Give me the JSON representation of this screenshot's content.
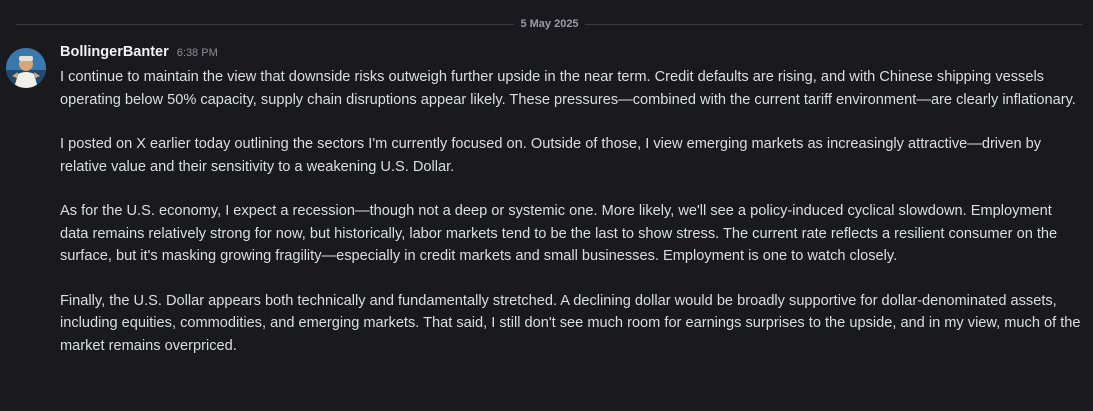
{
  "date_divider": "5 May 2025",
  "message": {
    "username": "BollingerBanter",
    "timestamp": "6:38 PM",
    "avatar_icon": "user-avatar-icon",
    "paragraphs": [
      "I continue to maintain the view that downside risks outweigh further upside in the near term. Credit defaults are rising, and with Chinese shipping vessels operating below 50% capacity, supply chain disruptions appear likely. These pressures—combined with the current tariff environment—are clearly inflationary.",
      "I posted on X earlier today outlining the sectors I'm currently focused on. Outside of those, I view emerging markets as increasingly attractive—driven by relative value and their sensitivity to a weakening U.S. Dollar.",
      "As for the U.S. economy, I expect a recession—though not a deep or systemic one. More likely, we'll see a policy-induced cyclical slowdown. Employment data remains relatively strong for now, but historically, labor markets tend to be the last to show stress. The current rate reflects a resilient consumer on the surface, but it's masking growing fragility—especially in credit markets and small businesses. Employment is one to watch closely.",
      "Finally, the U.S. Dollar appears both technically and fundamentally stretched. A declining dollar would be broadly supportive for dollar-denominated assets, including equities, commodities, and emerging markets. That said, I still don't see much room for earnings surprises to the upside, and in my view, much of the market remains overpriced."
    ]
  },
  "colors": {
    "background": "#1a1a1e",
    "text": "#dbdee1",
    "username": "#f2f3f5",
    "muted": "#8e8f96"
  }
}
